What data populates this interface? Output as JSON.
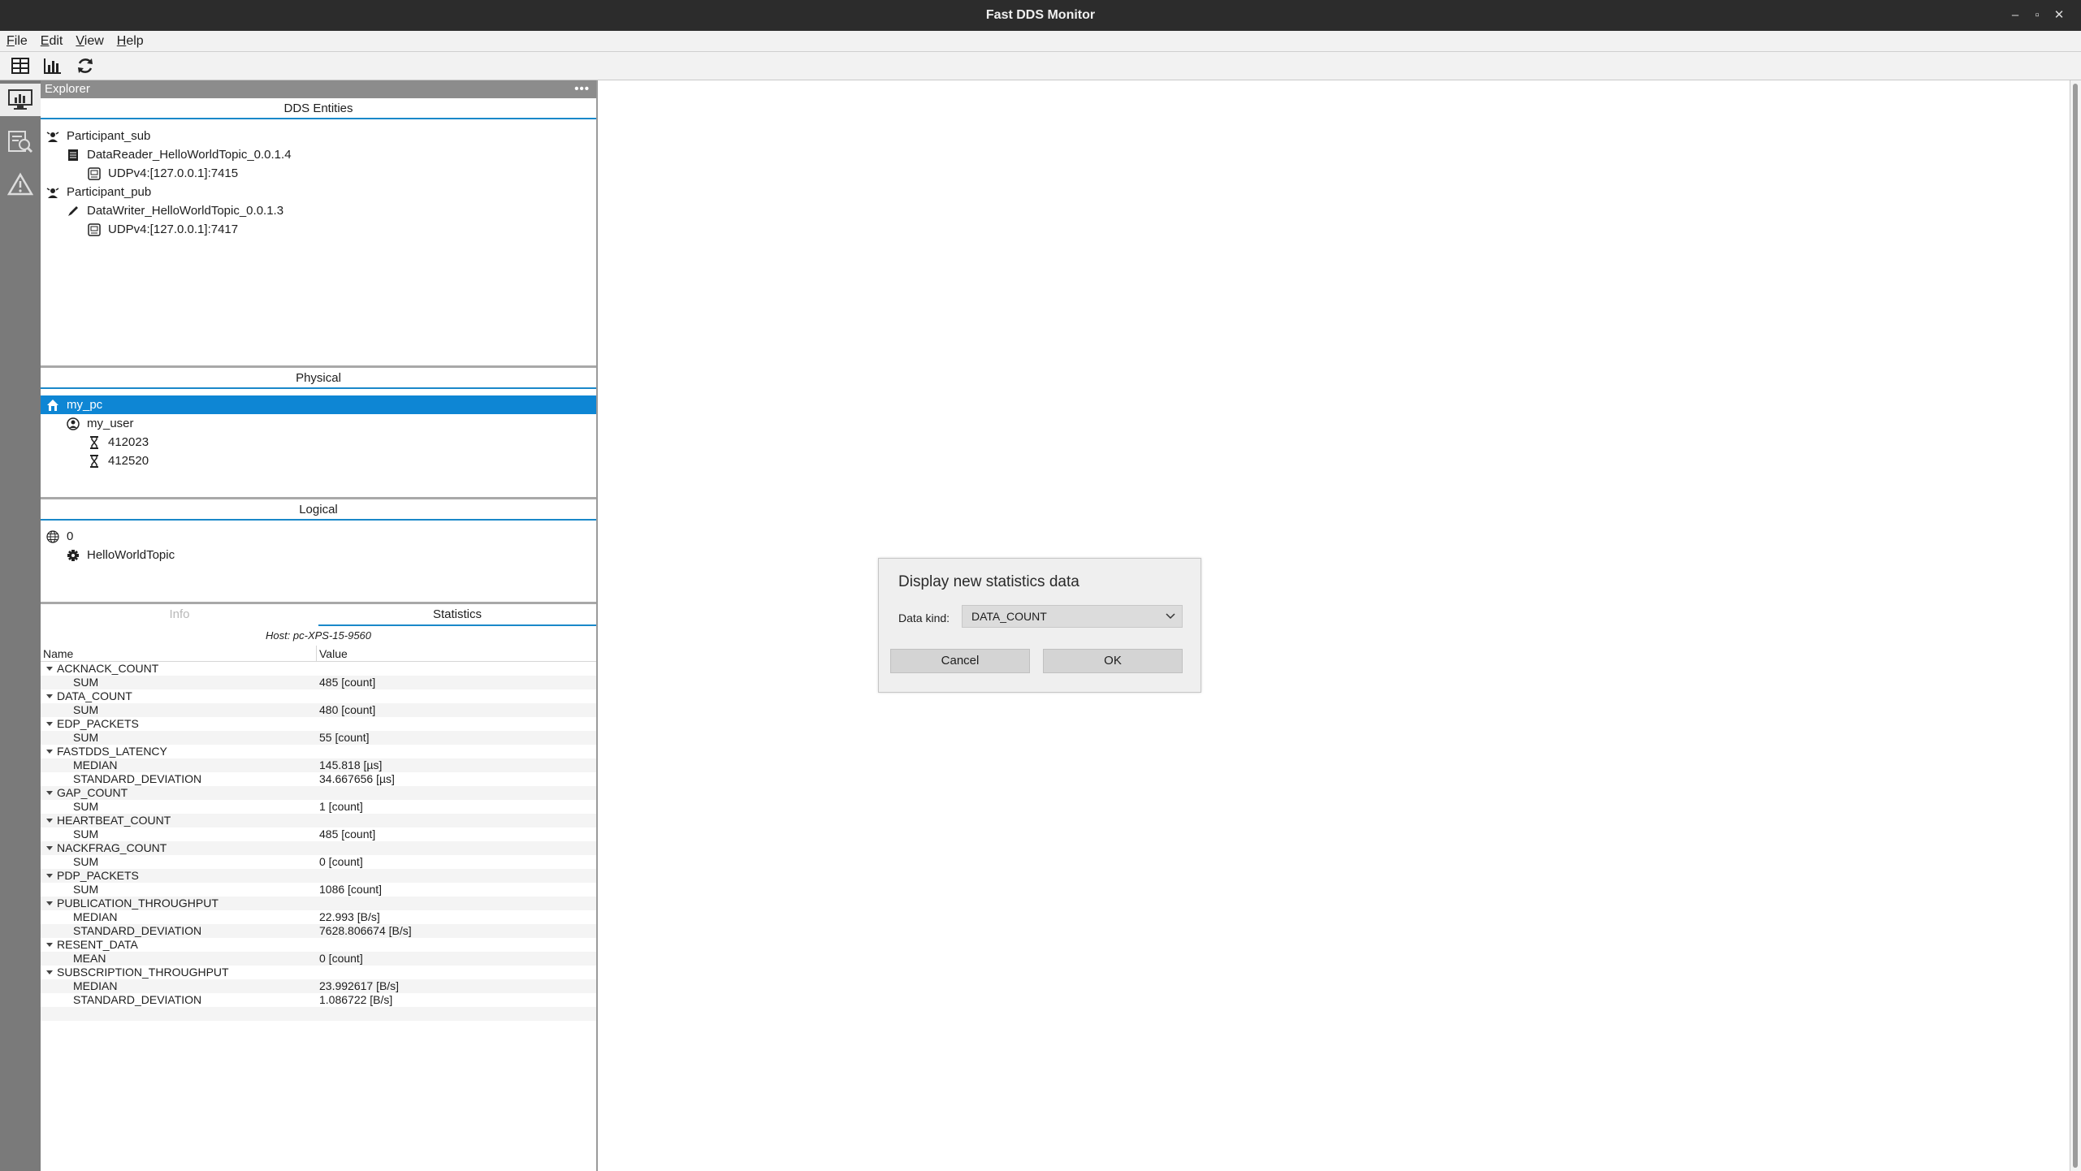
{
  "window": {
    "title": "Fast DDS Monitor"
  },
  "menu": {
    "items": [
      "File",
      "Edit",
      "View",
      "Help"
    ]
  },
  "explorer": {
    "header": "Explorer",
    "dds_entities": {
      "title": "DDS Entities",
      "rows": [
        {
          "label": "Participant_sub",
          "icon": "participant-icon",
          "indent": 0
        },
        {
          "label": "DataReader_HelloWorldTopic_0.0.1.4",
          "icon": "datareader-icon",
          "indent": 1
        },
        {
          "label": "UDPv4:[127.0.0.1]:7415",
          "icon": "locator-icon",
          "indent": 2
        },
        {
          "label": "Participant_pub",
          "icon": "participant-icon",
          "indent": 0
        },
        {
          "label": "DataWriter_HelloWorldTopic_0.0.1.3",
          "icon": "datawriter-icon",
          "indent": 1
        },
        {
          "label": "UDPv4:[127.0.0.1]:7417",
          "icon": "locator-icon",
          "indent": 2
        }
      ]
    },
    "physical": {
      "title": "Physical",
      "rows": [
        {
          "label": "my_pc",
          "icon": "host-icon",
          "indent": 0,
          "selected": true
        },
        {
          "label": "my_user",
          "icon": "user-icon",
          "indent": 1
        },
        {
          "label": "412023",
          "icon": "process-icon",
          "indent": 2
        },
        {
          "label": "412520",
          "icon": "process-icon",
          "indent": 2
        }
      ]
    },
    "logical": {
      "title": "Logical",
      "rows": [
        {
          "label": "0",
          "icon": "domain-icon",
          "indent": 0
        },
        {
          "label": "HelloWorldTopic",
          "icon": "topic-icon",
          "indent": 1
        }
      ]
    }
  },
  "tabs": {
    "info": "Info",
    "statistics": "Statistics"
  },
  "statistics": {
    "host": "Host: pc-XPS-15-9560",
    "col_name": "Name",
    "col_value": "Value",
    "groups": [
      {
        "name": "ACKNACK_COUNT",
        "items": [
          {
            "name": "SUM",
            "value": "485 [count]"
          }
        ]
      },
      {
        "name": "DATA_COUNT",
        "items": [
          {
            "name": "SUM",
            "value": "480 [count]"
          }
        ]
      },
      {
        "name": "EDP_PACKETS",
        "items": [
          {
            "name": "SUM",
            "value": "55 [count]"
          }
        ]
      },
      {
        "name": "FASTDDS_LATENCY",
        "items": [
          {
            "name": "MEDIAN",
            "value": "145.818 [µs]"
          },
          {
            "name": "STANDARD_DEVIATION",
            "value": "34.667656 [µs]"
          }
        ]
      },
      {
        "name": "GAP_COUNT",
        "items": [
          {
            "name": "SUM",
            "value": "1 [count]"
          }
        ]
      },
      {
        "name": "HEARTBEAT_COUNT",
        "items": [
          {
            "name": "SUM",
            "value": "485 [count]"
          }
        ]
      },
      {
        "name": "NACKFRAG_COUNT",
        "items": [
          {
            "name": "SUM",
            "value": "0 [count]"
          }
        ]
      },
      {
        "name": "PDP_PACKETS",
        "items": [
          {
            "name": "SUM",
            "value": "1086 [count]"
          }
        ]
      },
      {
        "name": "PUBLICATION_THROUGHPUT",
        "items": [
          {
            "name": "MEDIAN",
            "value": "22.993 [B/s]"
          },
          {
            "name": "STANDARD_DEVIATION",
            "value": "7628.806674 [B/s]"
          }
        ]
      },
      {
        "name": "RESENT_DATA",
        "items": [
          {
            "name": "MEAN",
            "value": "0 [count]"
          }
        ]
      },
      {
        "name": "SUBSCRIPTION_THROUGHPUT",
        "items": [
          {
            "name": "MEDIAN",
            "value": "23.992617 [B/s]"
          },
          {
            "name": "STANDARD_DEVIATION",
            "value": "1.086722 [B/s]"
          }
        ]
      }
    ]
  },
  "dialog": {
    "title": "Display new statistics data",
    "data_kind_label": "Data kind:",
    "data_kind_value": "DATA_COUNT",
    "cancel": "Cancel",
    "ok": "OK"
  },
  "colors": {
    "selection": "#0e86d4",
    "accent": "#1a88c9",
    "titlebar": "#2c2c2c"
  }
}
